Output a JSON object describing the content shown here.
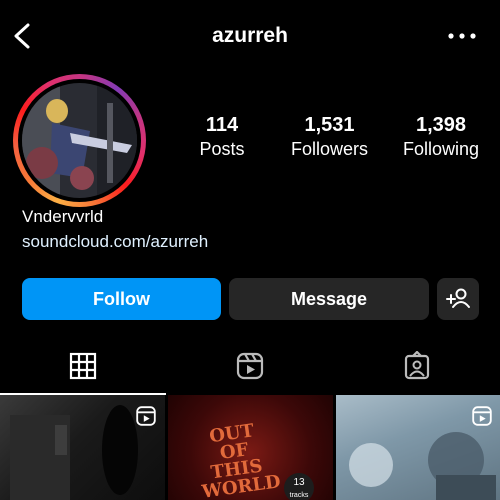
{
  "header": {
    "username": "azurreh",
    "back_icon": "chevron-left-icon",
    "more_icon": "more-horizontal-icon"
  },
  "profile": {
    "stats": [
      {
        "value": "114",
        "label": "Posts"
      },
      {
        "value": "1,531",
        "label": "Followers"
      },
      {
        "value": "1,398",
        "label": "Following"
      }
    ],
    "bio_name": "Vndervvrld",
    "bio_link": "soundcloud.com/azurreh"
  },
  "actions": {
    "follow_label": "Follow",
    "message_label": "Message",
    "add_user_icon": "add-user-icon"
  },
  "tabs": [
    {
      "name": "grid",
      "icon": "grid-icon",
      "active": true
    },
    {
      "name": "reels",
      "icon": "reels-icon",
      "active": false
    },
    {
      "name": "tagged",
      "icon": "tagged-icon",
      "active": false
    }
  ],
  "posts": [
    {
      "type": "reel"
    },
    {
      "type": "post",
      "art_text": "OUT OF THIS WORLD",
      "badge_count": "13",
      "badge_label": "tracks"
    },
    {
      "type": "reel"
    }
  ],
  "colors": {
    "follow_button": "#0095f6",
    "secondary_button": "#262626",
    "background": "#000000"
  }
}
